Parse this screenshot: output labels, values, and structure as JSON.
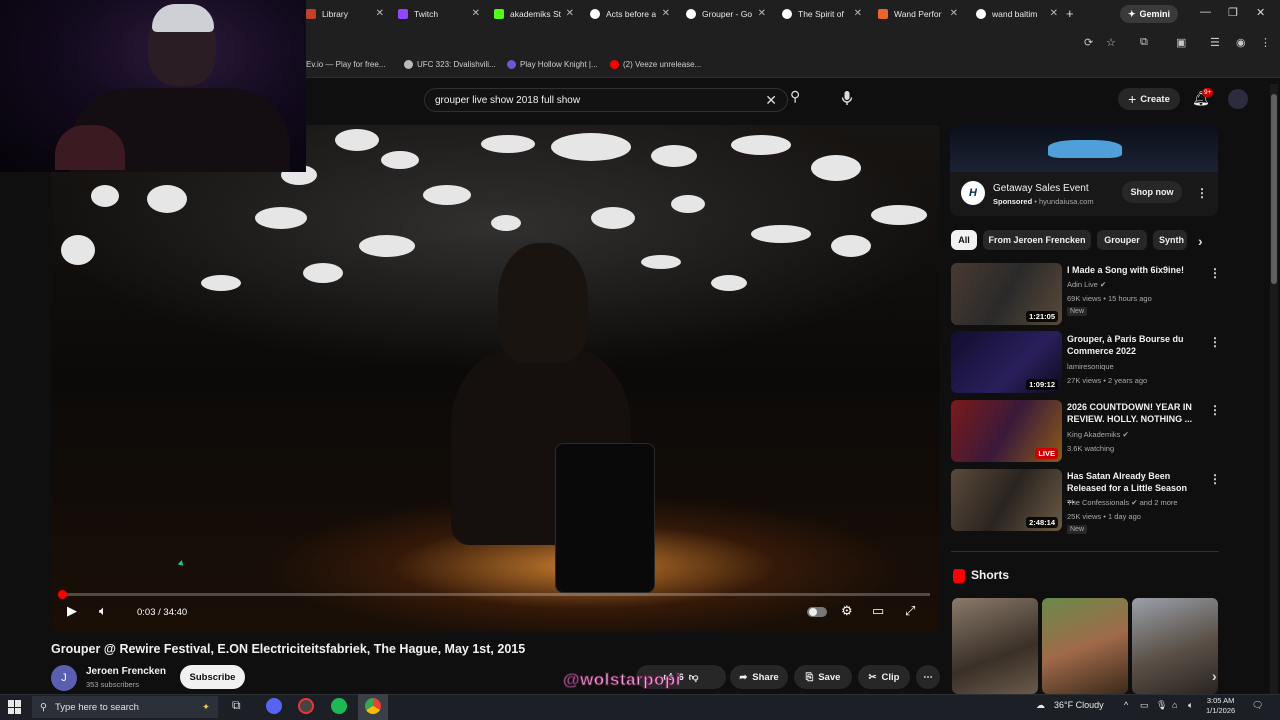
{
  "browser": {
    "tabs": [
      {
        "label": "Library",
        "color": "#c2412d"
      },
      {
        "label": "Twitch",
        "color": "#9146ff"
      },
      {
        "label": "akademiks St",
        "color": "#53fc18"
      },
      {
        "label": "Acts before a",
        "color": "#f1f1f1"
      },
      {
        "label": "Grouper - Go",
        "color": "#f1f1f1"
      },
      {
        "label": "The Spirit of",
        "color": "#f1f1f1"
      },
      {
        "label": "Wand Perfor",
        "color": "#e8662e"
      },
      {
        "label": "wand baltim",
        "color": "#f1f1f1"
      }
    ],
    "new_tab": "+",
    "gemini_label": "Gemini",
    "bookmarks": [
      {
        "label": "Ev.io — Play for free...",
        "color": "#3b82f6"
      },
      {
        "label": "UFC 323: Dvalishvili...",
        "color": "#bbbbbb"
      },
      {
        "label": "Play Hollow Knight |...",
        "color": "#6a5acd"
      },
      {
        "label": "(2) Veeze unrelease...",
        "color": "#ff0000"
      }
    ]
  },
  "header": {
    "search_query": "grouper live show 2018 full show",
    "create_label": "Create",
    "notifications_badge": "9+"
  },
  "player": {
    "time": "0:03 / 34:40",
    "progress": 0.0014
  },
  "video": {
    "title": "Grouper @ Rewire Festival, E.ON Electriciteitsfabriek, The Hague, May 1st, 2015",
    "channel_initial": "J",
    "channel_name": "Jeroen Frencken",
    "subscribers": "353 subscribers",
    "subscribe_label": "Subscribe",
    "like_count": "6",
    "share_label": "Share",
    "save_label": "Save",
    "clip_label": "Clip",
    "watermark": "@wolstarpopi"
  },
  "ad": {
    "title": "Getaway Sales Event",
    "sponsored": "Sponsored",
    "domain": "hyundaiusa.com",
    "shop_label": "Shop now",
    "logo": "H"
  },
  "chips": [
    "All",
    "From Jeroen Frencken",
    "Grouper",
    "Synth"
  ],
  "recommendations": [
    {
      "title": "I Made a Song with 6ix9ine!",
      "channel": "Adin Live",
      "meta": "69K views • 15 hours ago",
      "badge": "New",
      "duration": "1:21:05",
      "live": false,
      "thumb": "#3a2a22"
    },
    {
      "title": "Grouper, à Paris Bourse du Commerce 2022",
      "channel": "lamiresonique",
      "meta": "27K views • 2 years ago",
      "badge": "",
      "duration": "1:09:12",
      "live": false,
      "thumb": "#1c1440"
    },
    {
      "title": "2026 COUNTDOWN! YEAR IN REVIEW. HOLLY. NOTHING ...",
      "channel": "King Akademiks",
      "meta": "3.6K watching",
      "badge": "",
      "duration": "LIVE",
      "live": true,
      "thumb": "#5a1a1a"
    },
    {
      "title": "Has Satan Already Been Released for a Little Season ...",
      "channel": "The Confessionals",
      "meta": "25K views • 1 day ago",
      "badge": "New",
      "duration": "2:48:14",
      "live": false,
      "thumb": "#3a3226",
      "channel_extra": "and 2 more"
    }
  ],
  "shorts_title": "Shorts",
  "taskbar": {
    "search_placeholder": "Type here to search",
    "weather": "36°F Cloudy",
    "time": "3:05 AM",
    "date": "1/1/2026"
  }
}
